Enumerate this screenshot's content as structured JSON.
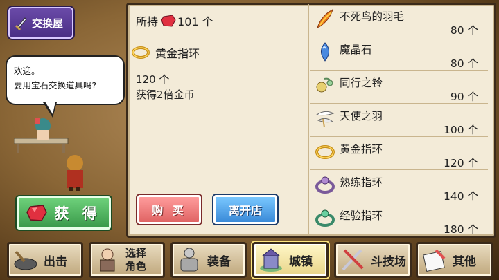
{
  "shop": {
    "title": "交换屋",
    "dialog_line1": "欢迎。",
    "dialog_line2": "要用宝石交换道具吗?",
    "obtain_label": "获 得"
  },
  "details": {
    "owned_label": "所持",
    "owned_count": "101 个",
    "selected_name": "黄金指环",
    "selected_price": "120 个",
    "selected_desc": "获得2倍金币",
    "buy_label": "购 买",
    "leave_label": "离开店"
  },
  "items": [
    {
      "name": "不死鸟的羽毛",
      "price": "80 个",
      "icon": "phoenix-feather-icon"
    },
    {
      "name": "魔晶石",
      "price": "80 个",
      "icon": "magic-crystal-icon"
    },
    {
      "name": "同行之铃",
      "price": "90 个",
      "icon": "bell-icon"
    },
    {
      "name": "天使之羽",
      "price": "100 个",
      "icon": "angel-feather-icon"
    },
    {
      "name": "黄金指环",
      "price": "120 个",
      "icon": "gold-ring-icon"
    },
    {
      "name": "熟练指环",
      "price": "140 个",
      "icon": "skill-ring-icon"
    },
    {
      "name": "经验指环",
      "price": "180 个",
      "icon": "exp-ring-icon"
    }
  ],
  "nav": {
    "sortie": "出击",
    "select_line1": "选择",
    "select_line2": "角色",
    "equip": "装备",
    "town": "城镇",
    "arena": "斗技场",
    "other": "其他"
  },
  "colors": {
    "panel_bg": "#f3ebd8",
    "obtain_green": "#3a9a4a",
    "buy_red": "#e06464",
    "leave_blue": "#3a8ad8",
    "title_purple": "#4a2f85"
  }
}
